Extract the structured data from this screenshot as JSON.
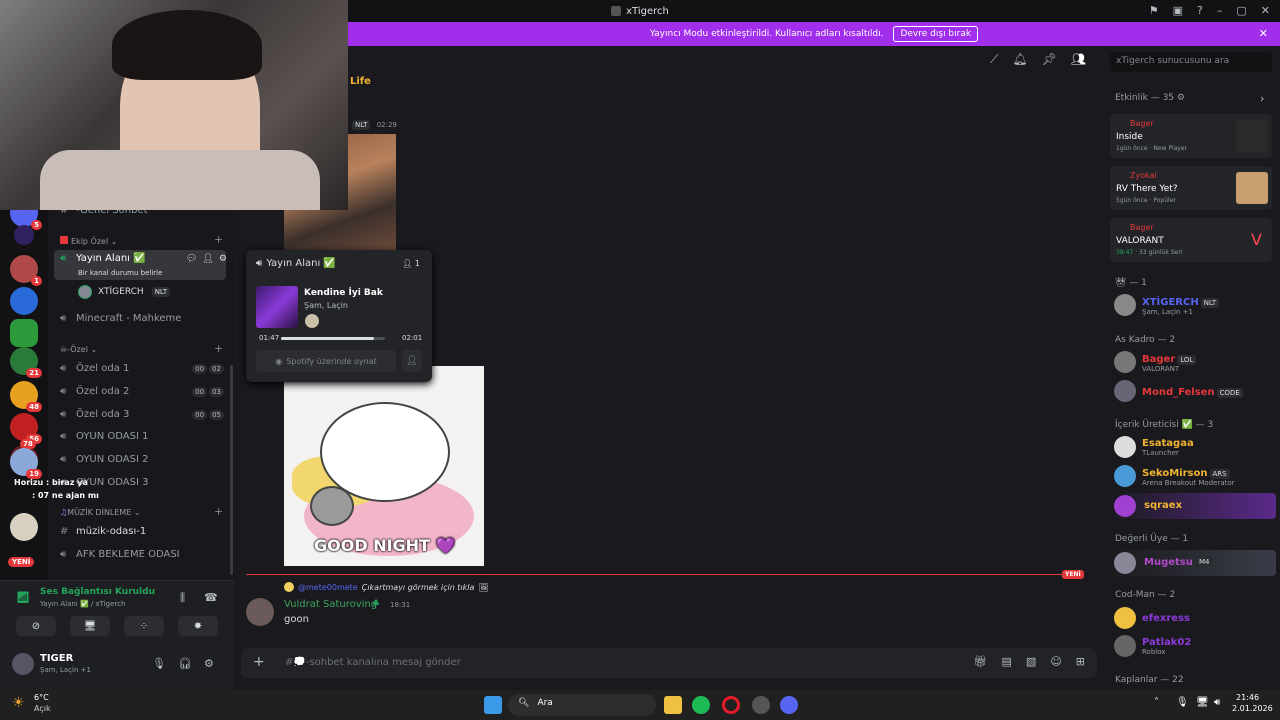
{
  "window": {
    "title": "xTigerch"
  },
  "banner": {
    "text": "Yayıncı Modu etkinleştirildi. Kullanıcı adları kısaltıldı.",
    "button": "Devre dışı bırak"
  },
  "servers": [
    {
      "badge": "5"
    },
    {
      "badge": ""
    },
    {
      "badge": "1"
    },
    {
      "badge": ""
    },
    {
      "badge": ""
    },
    {
      "badge": "21"
    },
    {
      "badge": "48"
    },
    {
      "badge": "56"
    },
    {
      "badge": "78"
    },
    {
      "badge": "19"
    },
    {
      "badge": ""
    },
    {
      "badge": "YENİ"
    }
  ],
  "channels": {
    "genel": "-Genel Sohbet",
    "cat_ekip": "Ekip Özel",
    "yayin": "Yayın Alanı ✅",
    "yayin_status": "Bir kanal durumu belirle",
    "voice_user": "XTİGERCH",
    "voice_user_tag": "NLT",
    "minecraft": "Minecraft - Mahkeme",
    "cat_ozel": "-Özel",
    "ozel1": "Özel oda 1",
    "ozel1_a": "00",
    "ozel1_b": "02",
    "ozel2": "Özel oda 2",
    "ozel2_a": "00",
    "ozel2_b": "03",
    "ozel3": "Özel oda 3",
    "ozel3_a": "00",
    "ozel3_b": "05",
    "oyun1": "OYUN ODASI 1",
    "oyun2": "OYUN ODASI 2",
    "oyun3": "OYUN ODASI 3",
    "cat_muzik": "MÜZİK DİNLEME",
    "muzik1": "müzik-odası-1",
    "afk": "AFK BEKLEME ODASI"
  },
  "overlay_chat": {
    "line1": "Horizu : biraz ya",
    "line2": ": 07 ne ajan mı"
  },
  "voice": {
    "status": "Ses Bağlantısı Kuruldu",
    "channel": "Yayın Alanı ✅ / xTigerch"
  },
  "user": {
    "name": "TIGER",
    "status": "Şam, Laçin +1"
  },
  "top": {
    "search_placeholder": "xTigerch sunucusunu ara"
  },
  "messages": {
    "chunk_label": "NLT",
    "chunk_time": "02:29",
    "top_fragment": "Life",
    "reply_user": "@mete00mete",
    "reply_text": "Çıkartmayı görmek için tıkla",
    "author": "Vuldrat Saturoving",
    "time": "18:31",
    "text": "goon",
    "new_label": "YENİ",
    "gif_text": "GOOD NIGHT 💜"
  },
  "popup": {
    "title": "Yayın Alanı ✅",
    "listeners": "1",
    "song": "Kendine İyi Bak",
    "artist": "Şam, Laçin",
    "elapsed": "01:47",
    "total": "02:01",
    "progress": 0.89,
    "play_button": "Spotify üzerinde oynat"
  },
  "input": {
    "placeholder": "#💭-sohbet kanalına mesaj gönder"
  },
  "activity": {
    "header": "Etkinlik — 35",
    "items": [
      {
        "user": "Bager",
        "game": "Inside",
        "meta1": "1gün önce",
        "meta2": "New Player"
      },
      {
        "user": "Zyokai",
        "game": "RV There Yet?",
        "meta1": "5gün önce",
        "meta2": "Popüler"
      },
      {
        "user": "Bager",
        "game": "VALORANT",
        "meta1": "38:47",
        "meta2": "33 günlük Seri"
      }
    ]
  },
  "members": {
    "sec1": "— 1",
    "m1": {
      "name": "XTİGERCH",
      "tag": "NLT",
      "sub": "Şam, Laçin +1"
    },
    "sec2": "As Kadro — 2",
    "m2": {
      "name": "Bager",
      "tag": "LOL",
      "sub": "VALORANT"
    },
    "m3": {
      "name": "Mond_Felsen",
      "tag": "CODE"
    },
    "sec3": "İçerik Üreticisi ✅ — 3",
    "m4": {
      "name": "Esatagaa",
      "sub": "TLauncher"
    },
    "m5": {
      "name": "SekoMirson",
      "tag": "ARS",
      "sub": "Arena Breakout Moderator"
    },
    "m6": {
      "name": "sqraex"
    },
    "sec4": "Değerli Üye — 1",
    "m7": {
      "name": "Mugetsu",
      "tag": "M4"
    },
    "sec5": "Cod-Man — 2",
    "m8": {
      "name": "efexress"
    },
    "m9": {
      "name": "Patlak02",
      "sub": "Roblox"
    },
    "sec6": "Kaplanlar — 22"
  },
  "taskbar": {
    "weather_temp": "6°C",
    "weather_desc": "Açık",
    "search": "Ara",
    "time": "21:46",
    "date": "2.01.2026"
  },
  "colors": {
    "accent": "#a02eeb",
    "danger": "#e5383b",
    "online": "#23a55a"
  }
}
